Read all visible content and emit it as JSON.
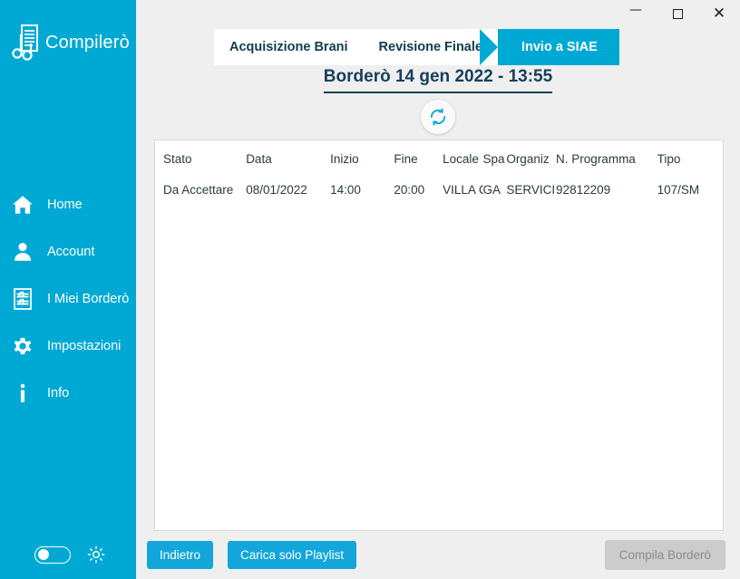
{
  "window": {
    "controls": [
      {
        "name": "minimize",
        "glyph": "—"
      },
      {
        "name": "maximize",
        "glyph": "□"
      },
      {
        "name": "close",
        "glyph": "✕"
      }
    ]
  },
  "sidebar": {
    "brand": "Compilerò",
    "items": [
      {
        "label": "Home",
        "icon": "home-icon"
      },
      {
        "label": "Account",
        "icon": "user-icon"
      },
      {
        "label": "I Miei Borderò",
        "icon": "score-sheet-icon"
      },
      {
        "label": "Impostazioni",
        "icon": "gear-icon"
      },
      {
        "label": "Info",
        "icon": "info-icon"
      }
    ],
    "footer": {
      "theme_toggle_state": "off",
      "brightness_icon": "sun-icon"
    }
  },
  "steps": [
    {
      "label": "Acquisizione Brani",
      "active": false
    },
    {
      "label": "Revisione Finale",
      "active": false
    },
    {
      "label": "Invio a SIAE",
      "active": true
    }
  ],
  "page": {
    "title": "Borderò 14 gen 2022 - 13:55",
    "refresh_icon": "refresh-icon"
  },
  "table": {
    "columns": [
      "Stato",
      "Data",
      "Inizio",
      "Fine",
      "Locale",
      "Spa",
      "Organiz",
      "N. Programma",
      "Tipo"
    ],
    "rows": [
      {
        "stato": "Da Accettare",
        "data": "08/01/2022",
        "inizio": "14:00",
        "fine": "20:00",
        "locale": "VILLA C",
        "spazio": "GA",
        "organizzatore": "SERVICI",
        "n_programma": "92812209",
        "tipo": "107/SM"
      }
    ]
  },
  "footer": {
    "back_button": "Indietro",
    "playlist_button": "Carica solo Playlist",
    "compile_button": "Compila Borderò"
  },
  "colors": {
    "accent": "#00a9d4",
    "button": "#13a6db",
    "title_text": "#16405a",
    "panel_bg": "#efefef",
    "disabled_bg": "#cccccc"
  }
}
